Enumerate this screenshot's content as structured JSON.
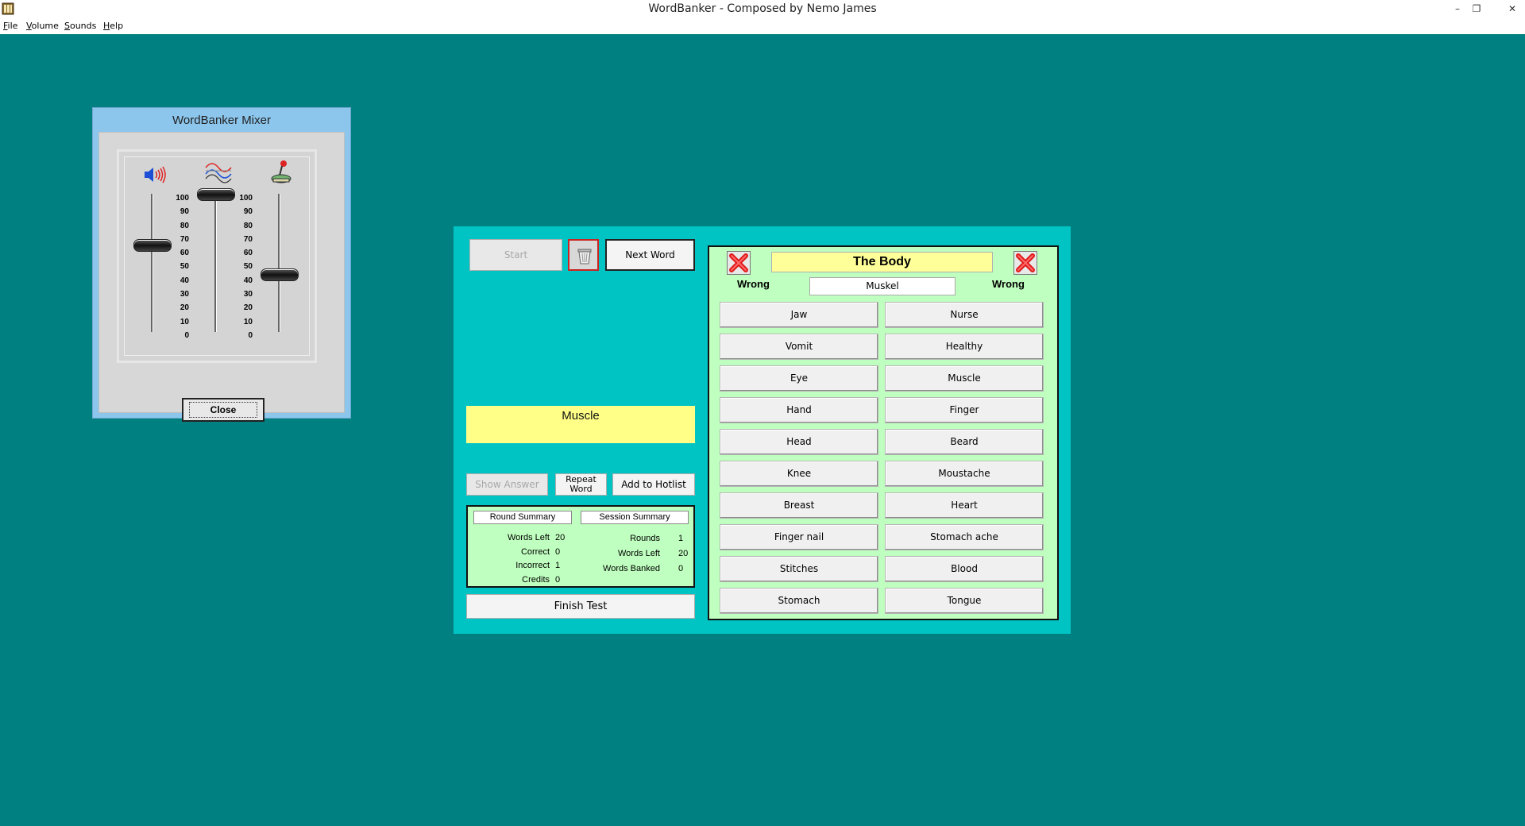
{
  "window": {
    "title": "WordBanker - Composed by Nemo James",
    "minimize": "–",
    "restore": "❐",
    "close": "✕"
  },
  "menu": [
    "File",
    "Volume",
    "Sounds",
    "Help"
  ],
  "mixer": {
    "title": "WordBanker Mixer",
    "scale": [
      "100",
      "90",
      "80",
      "70",
      "60",
      "50",
      "40",
      "30",
      "20",
      "10",
      "0"
    ],
    "sliders": [
      {
        "name": "volume",
        "level": 63
      },
      {
        "name": "effects",
        "level": 100
      },
      {
        "name": "music",
        "level": 42
      }
    ],
    "close_label": "Close"
  },
  "controls": {
    "start": "Start",
    "next_word": "Next Word",
    "answer": "Muscle",
    "show_answer": "Show Answer",
    "repeat_word": "Repeat Word",
    "add_to_hotlist": "Add to  Hotlist",
    "finish_test": "Finish Test"
  },
  "summary": {
    "round_tab": "Round Summary",
    "session_tab": "Session Summary",
    "round": [
      {
        "label": "Words Left",
        "value": "20"
      },
      {
        "label": "Correct",
        "value": "0"
      },
      {
        "label": "Incorrect",
        "value": "1"
      },
      {
        "label": "Credits",
        "value": "0"
      }
    ],
    "session": [
      {
        "label": "Rounds",
        "value": "1"
      },
      {
        "label": "Words Left",
        "value": "20"
      },
      {
        "label": "Words Banked",
        "value": "0"
      }
    ]
  },
  "words": {
    "category": "The Body",
    "wrong_left": "Wrong",
    "wrong_right": "Wrong",
    "input": "Muskel",
    "left": [
      "Jaw",
      "Vomit",
      "Eye",
      "Hand",
      "Head",
      "Knee",
      "Breast",
      "Finger nail",
      "Stitches",
      "Stomach"
    ],
    "right": [
      "Nurse",
      "Healthy",
      "Muscle",
      "Finger",
      "Beard",
      "Moustache",
      "Heart",
      "Stomach ache",
      "Blood",
      "Tongue"
    ]
  }
}
